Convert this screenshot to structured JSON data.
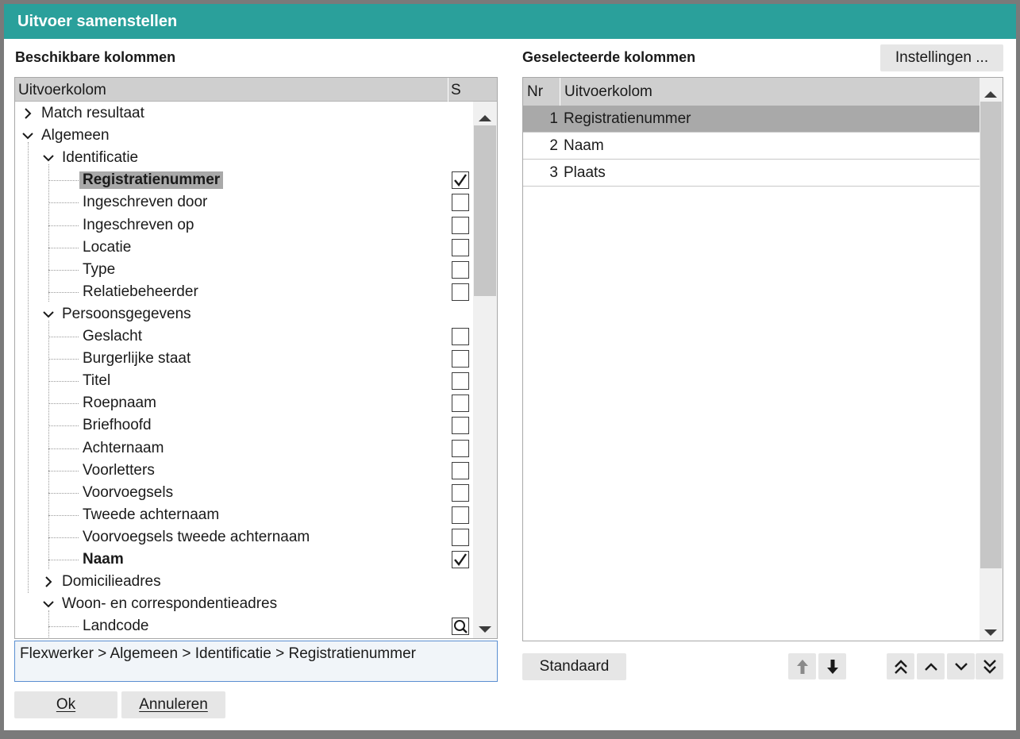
{
  "dialog": {
    "title": "Uitvoer samenstellen",
    "available_label": "Beschikbare kolommen",
    "selected_label": "Geselecteerde kolommen",
    "settings_button": "Instellingen ...",
    "standard_button": "Standaard",
    "ok_button": "Ok",
    "cancel_button": "Annuleren"
  },
  "tree": {
    "col_name": "Uitvoerkolom",
    "col_s": "S",
    "rows": [
      {
        "label": "Match resultaat",
        "level": 0,
        "expander": "collapsed"
      },
      {
        "label": "Algemeen",
        "level": 0,
        "expander": "expanded"
      },
      {
        "label": "Identificatie",
        "level": 1,
        "expander": "expanded"
      },
      {
        "label": "Registratienummer",
        "level": 2,
        "bold": true,
        "selected": true,
        "control": "checked"
      },
      {
        "label": "Ingeschreven door",
        "level": 2,
        "control": "unchecked"
      },
      {
        "label": "Ingeschreven op",
        "level": 2,
        "control": "unchecked"
      },
      {
        "label": "Locatie",
        "level": 2,
        "control": "unchecked"
      },
      {
        "label": "Type",
        "level": 2,
        "control": "unchecked"
      },
      {
        "label": "Relatiebeheerder",
        "level": 2,
        "control": "unchecked"
      },
      {
        "label": "Persoonsgegevens",
        "level": 1,
        "expander": "expanded"
      },
      {
        "label": "Geslacht",
        "level": 2,
        "control": "unchecked"
      },
      {
        "label": "Burgerlijke staat",
        "level": 2,
        "control": "unchecked"
      },
      {
        "label": "Titel",
        "level": 2,
        "control": "unchecked"
      },
      {
        "label": "Roepnaam",
        "level": 2,
        "control": "unchecked"
      },
      {
        "label": "Briefhoofd",
        "level": 2,
        "control": "unchecked"
      },
      {
        "label": "Achternaam",
        "level": 2,
        "control": "unchecked"
      },
      {
        "label": "Voorletters",
        "level": 2,
        "control": "unchecked"
      },
      {
        "label": "Voorvoegsels",
        "level": 2,
        "control": "unchecked"
      },
      {
        "label": "Tweede achternaam",
        "level": 2,
        "control": "unchecked"
      },
      {
        "label": "Voorvoegsels tweede achternaam",
        "level": 2,
        "control": "unchecked"
      },
      {
        "label": "Naam",
        "level": 2,
        "bold": true,
        "control": "checked"
      },
      {
        "label": "Domicilieadres",
        "level": 1,
        "expander": "collapsed"
      },
      {
        "label": "Woon- en correspondentieadres",
        "level": 1,
        "expander": "expanded"
      },
      {
        "label": "Landcode",
        "level": 2,
        "control": "search"
      }
    ]
  },
  "path": "Flexwerker > Algemeen > Identificatie > Registratienummer",
  "selected_list": {
    "col_nr": "Nr",
    "col_name": "Uitvoerkolom",
    "rows": [
      {
        "nr": "1",
        "label": "Registratienummer",
        "selected": true
      },
      {
        "nr": "2",
        "label": "Naam"
      },
      {
        "nr": "3",
        "label": "Plaats"
      }
    ]
  },
  "icons": {
    "move_up": "arrow-up-icon",
    "move_down": "arrow-down-icon",
    "move_top": "double-chevron-up-icon",
    "move_one_up": "chevron-up-icon",
    "move_one_down": "chevron-down-icon",
    "move_bottom": "double-chevron-down-icon"
  }
}
